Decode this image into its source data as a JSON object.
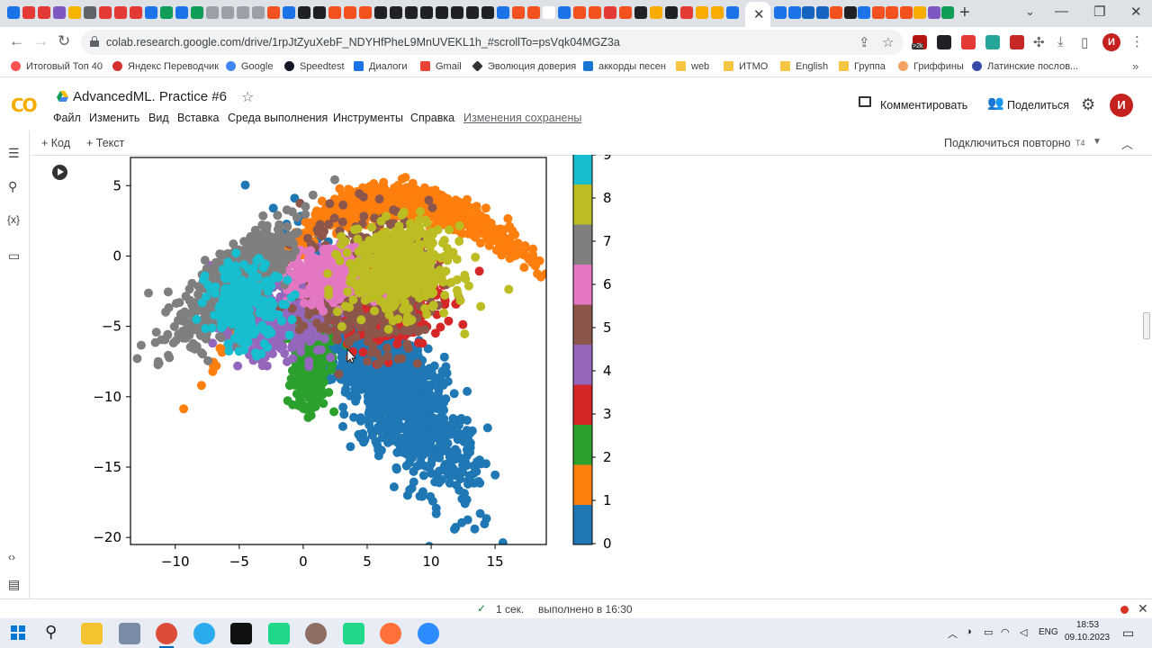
{
  "browser": {
    "url": "colab.research.google.com/drive/1rpJtZyuXebF_NDYHfPheL9MnUVEKL1h_#scrollTo=psVqk04MGZ3a",
    "extension_badge": ">2k",
    "profile_initial": "И",
    "bookmarks": [
      {
        "label": "Итоговый Топ 40",
        "icon": "music-icon"
      },
      {
        "label": "Яндекс Переводчик",
        "icon": "translate-icon"
      },
      {
        "label": "Google",
        "icon": "google-icon"
      },
      {
        "label": "Speedtest",
        "icon": "speedtest-icon"
      },
      {
        "label": "Диалоги",
        "icon": "dialogs-icon"
      },
      {
        "label": "Gmail",
        "icon": "gmail-icon"
      },
      {
        "label": "Эволюция доверия",
        "icon": "diamond-icon"
      },
      {
        "label": "аккорды песен",
        "icon": "chords-icon"
      },
      {
        "label": "web",
        "icon": "folder-icon"
      },
      {
        "label": "ИТМО",
        "icon": "folder-icon"
      },
      {
        "label": "English",
        "icon": "folder-icon"
      },
      {
        "label": "Группа",
        "icon": "folder-icon"
      },
      {
        "label": "Гриффины",
        "icon": "griffins-icon"
      },
      {
        "label": "Латинские послов...",
        "icon": "audio-icon"
      }
    ]
  },
  "colab": {
    "logo": "CO",
    "title": "AdvancedML. Practice #6",
    "menu": [
      "Файл",
      "Изменить",
      "Вид",
      "Вставка",
      "Среда выполнения",
      "Инструменты",
      "Справка"
    ],
    "saved_status": "Изменения сохранены",
    "comment_label": "Комментировать",
    "share_label": "Поделиться",
    "user_initial": "И",
    "add_code": "+ Код",
    "add_text": "+ Текст",
    "reconnect_label": "Подключиться повторно",
    "runtime_type": "T4",
    "status_time": "1 сек.",
    "status_done": "выполнено в 16:30"
  },
  "taskbar": {
    "lang": "ENG",
    "time": "18:53",
    "date": "09.10.2023"
  },
  "chart_data": {
    "type": "scatter",
    "title": "",
    "xlabel": "",
    "ylabel": "",
    "xlim": [
      -13.5,
      19
    ],
    "ylim": [
      -20.5,
      7
    ],
    "xticks": [
      -10,
      -5,
      0,
      5,
      10,
      15
    ],
    "yticks": [
      5,
      0,
      -5,
      -10,
      -15,
      -20
    ],
    "colorbar": {
      "ticks": [
        0,
        1,
        2,
        3,
        4,
        5,
        6,
        7,
        8,
        9
      ],
      "colors": [
        "#1f77b4",
        "#ff7f0e",
        "#2ca02c",
        "#d62728",
        "#9467bd",
        "#8c564b",
        "#e377c2",
        "#7f7f7f",
        "#bcbd22",
        "#17becf"
      ]
    },
    "series": [
      {
        "label": 0,
        "color": "#1f77b4",
        "center": [
          6.5,
          -8.5
        ],
        "spread": [
          3.2,
          3.6
        ],
        "points": 1400,
        "extent": "x 2 to 15, y -19.5 to -4"
      },
      {
        "label": 1,
        "color": "#ff7f0e",
        "center": [
          7,
          3.8
        ],
        "spread": [
          5.5,
          0.9
        ],
        "points": 900,
        "extent": "x -1 to 18, y 1 to 6"
      },
      {
        "label": 2,
        "color": "#2ca02c",
        "center": [
          0.5,
          -6.5
        ],
        "spread": [
          0.8,
          2.2
        ],
        "points": 300,
        "extent": "x -1 to 2.5, y -11 to -3"
      },
      {
        "label": 3,
        "color": "#d62728",
        "center": [
          6.5,
          -3
        ],
        "spread": [
          2.2,
          1.6
        ],
        "points": 400,
        "extent": "x 2 to 14, y -7.5 to 0"
      },
      {
        "label": 4,
        "color": "#9467bd",
        "center": [
          -2.5,
          -4.5
        ],
        "spread": [
          2,
          1.2
        ],
        "points": 500,
        "extent": "x -7 to 0, y -7 to -1"
      },
      {
        "label": 5,
        "color": "#8c564b",
        "center": [
          5,
          -2
        ],
        "spread": [
          2.5,
          2.5
        ],
        "points": 400,
        "extent": "x 1 to 10, y -8 to 1.5"
      },
      {
        "label": 6,
        "color": "#e377c2",
        "center": [
          2,
          -1.5
        ],
        "spread": [
          1.5,
          1
        ],
        "points": 300,
        "extent": "x -1 to 5, y -3.5 to 0"
      },
      {
        "label": 7,
        "color": "#7f7f7f",
        "center": [
          -5.5,
          -2
        ],
        "spread": [
          2.2,
          2.5
        ],
        "points": 600,
        "extent": "x -12.5 to -1, y -8 to 3.5"
      },
      {
        "label": 8,
        "color": "#bcbd22",
        "center": [
          7.5,
          -1
        ],
        "spread": [
          2,
          1.5
        ],
        "points": 500,
        "extent": "x 4 to 12, y -5 to 2"
      },
      {
        "label": 9,
        "color": "#17becf",
        "center": [
          -4.5,
          -3.5
        ],
        "spread": [
          1.5,
          1.5
        ],
        "points": 200,
        "extent": "x -7 to -2, y -7 to -1"
      }
    ]
  }
}
